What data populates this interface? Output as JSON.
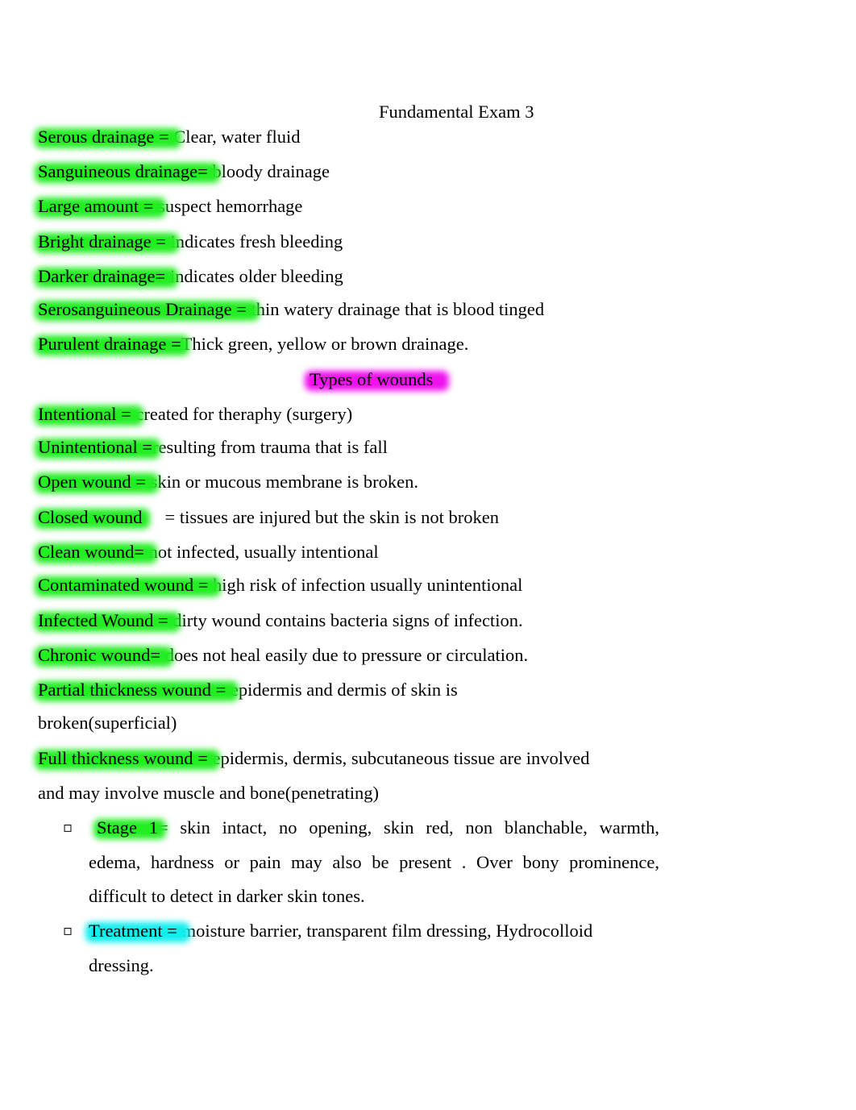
{
  "document": {
    "title": "Fundamental Exam 3",
    "section_heading": "Types of wounds",
    "highlight_colors": {
      "term": "#22ee22",
      "section": "#ee11ee",
      "treatment": "#11eeee"
    },
    "bullet_icon": "",
    "drainage_terms": [
      {
        "term": "Serous drainage = ",
        "definition": "Clear, water fluid"
      },
      {
        "term": "Sanguineous drainage= ",
        "definition": "bloody drainage"
      },
      {
        "term": "Large amount = ",
        "definition": "suspect hemorrhage"
      },
      {
        "term": "Bright drainage = ",
        "definition": "indicates fresh bleeding"
      },
      {
        "term": "Darker drainage= ",
        "definition": "indicates older bleeding"
      },
      {
        "term": "Serosanguineous Drainage = ",
        "definition": "thin watery drainage that is blood tinged"
      },
      {
        "term": "Purulent drainage =",
        "definition": "Thick green, yellow or brown drainage."
      }
    ],
    "wound_terms": [
      {
        "term": "Intentional = ",
        "definition": "created for theraphy (surgery)"
      },
      {
        "term": "Unintentional =",
        "definition": "resulting from trauma that is fall"
      },
      {
        "term": "Open wound = ",
        "definition": "skin or mucous membrane is broken."
      },
      {
        "term": "Closed wound",
        "definition": "     = tissues are injured but the skin is not broken"
      },
      {
        "term": "Clean wound= ",
        "definition": "not infected, usually intentional"
      },
      {
        "term": "Contaminated wound = ",
        "definition": "high risk of infection usually unintentional"
      },
      {
        "term": "Infected Wound = ",
        "definition": "dirty wound contains bacteria signs of infection."
      },
      {
        "term": "Chronic wound= ",
        "definition": "does not heal easily due to pressure or circulation."
      },
      {
        "term": "Partial thickness wound = ",
        "definition": "epidermis and dermis of skin is",
        "continuation": "broken(superficial)"
      },
      {
        "term": "Full thickness wound = ",
        "definition": "epidermis, dermis, subcutaneous tissue are involved",
        "continuation": "and may involve muscle and bone(penetrating)"
      }
    ],
    "bullets": [
      {
        "term": "Stage 1",
        "eq": "=",
        "lines": [
          " skin intact, no opening, skin red, non blanchable, warmth,",
          "edema, hardness or pain may also be present . Over bony prominence,",
          "difficult to detect in darker skin tones."
        ]
      },
      {
        "term": "Treatment = ",
        "lines": [
          "moisture barrier, transparent film dressing, Hydrocolloid",
          "dressing."
        ]
      }
    ]
  }
}
